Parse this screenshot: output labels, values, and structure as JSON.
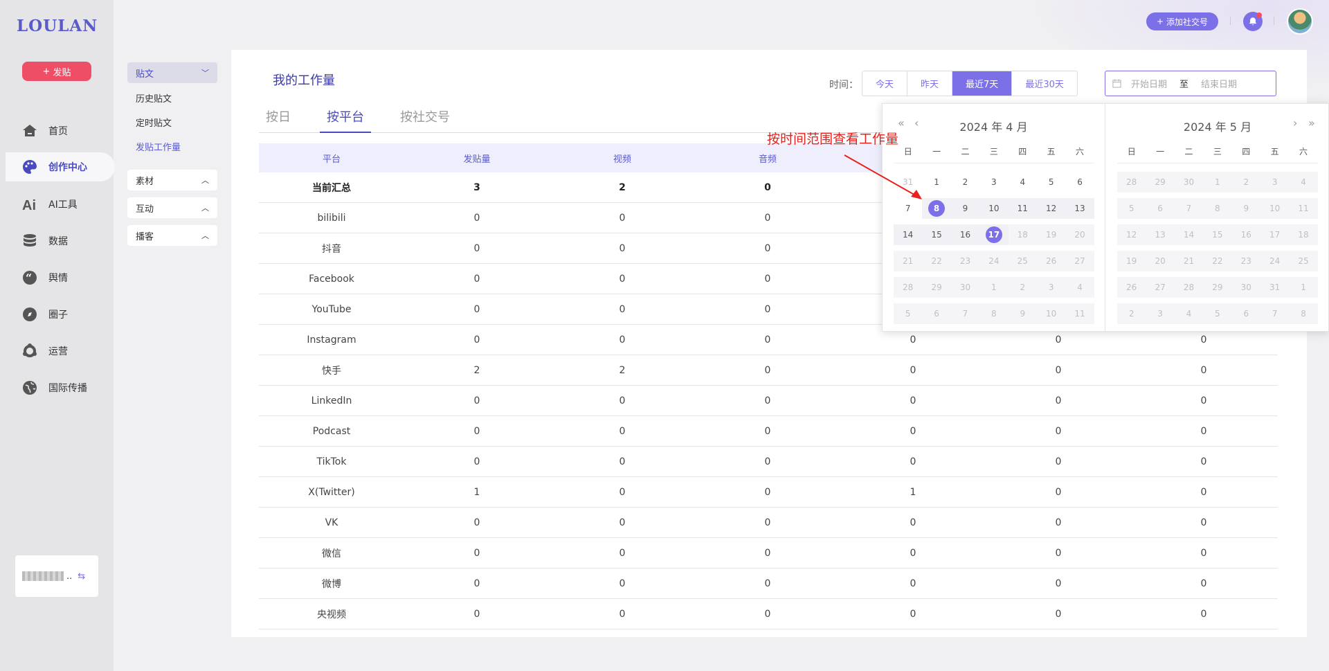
{
  "brand": {
    "logo": "LOULAN",
    "post_label": "发贴"
  },
  "nav": [
    {
      "label": "首页",
      "icon": "home-icon"
    },
    {
      "label": "创作中心",
      "icon": "palette-icon",
      "active": true
    },
    {
      "label": "AI工具",
      "icon": "ai-icon"
    },
    {
      "label": "数据",
      "icon": "database-icon"
    },
    {
      "label": "舆情",
      "icon": "quote-icon"
    },
    {
      "label": "圈子",
      "icon": "compass-icon"
    },
    {
      "label": "运营",
      "icon": "cluster-icon"
    },
    {
      "label": "国际传播",
      "icon": "globe-icon"
    }
  ],
  "account": {
    "suffix": ".."
  },
  "subnav": {
    "post_group": "贴文",
    "post_items": [
      "历史贴文",
      "定时贴文",
      "发贴工作量"
    ],
    "material": "素材",
    "interact": "互动",
    "podcast": "播客"
  },
  "topbar": {
    "add_social": "添加社交号"
  },
  "main": {
    "title": "我的工作量",
    "time_label": "时间：",
    "ranges": [
      "今天",
      "昨天",
      "最近7天",
      "最近30天"
    ],
    "active_range": 2,
    "start_placeholder": "开始日期",
    "to": "至",
    "end_placeholder": "结束日期",
    "tabs": [
      "按日",
      "按平台",
      "按社交号"
    ],
    "active_tab": 1
  },
  "table": {
    "headers": [
      "平台",
      "发贴量",
      "视频",
      "音频",
      "",
      "",
      ""
    ],
    "rows": [
      [
        "当前汇总",
        "3",
        "2",
        "0",
        "",
        "",
        ""
      ],
      [
        "bilibili",
        "0",
        "0",
        "0",
        "",
        "",
        ""
      ],
      [
        "抖音",
        "0",
        "0",
        "0",
        "",
        "",
        ""
      ],
      [
        "Facebook",
        "0",
        "0",
        "0",
        "",
        "",
        ""
      ],
      [
        "YouTube",
        "0",
        "0",
        "0",
        "",
        "",
        ""
      ],
      [
        "Instagram",
        "0",
        "0",
        "0",
        "0",
        "0",
        "0"
      ],
      [
        "快手",
        "2",
        "2",
        "0",
        "0",
        "0",
        "0"
      ],
      [
        "LinkedIn",
        "0",
        "0",
        "0",
        "0",
        "0",
        "0"
      ],
      [
        "Podcast",
        "0",
        "0",
        "0",
        "0",
        "0",
        "0"
      ],
      [
        "TikTok",
        "0",
        "0",
        "0",
        "0",
        "0",
        "0"
      ],
      [
        "X(Twitter)",
        "1",
        "0",
        "0",
        "1",
        "0",
        "0"
      ],
      [
        "VK",
        "0",
        "0",
        "0",
        "0",
        "0",
        "0"
      ],
      [
        "微信",
        "0",
        "0",
        "0",
        "0",
        "0",
        "0"
      ],
      [
        "微博",
        "0",
        "0",
        "0",
        "0",
        "0",
        "0"
      ],
      [
        "央视频",
        "0",
        "0",
        "0",
        "0",
        "0",
        "0"
      ]
    ]
  },
  "calendar": {
    "weekdays": [
      "日",
      "一",
      "二",
      "三",
      "四",
      "五",
      "六"
    ],
    "left_title": "2024 年 4 月",
    "right_title": "2024 年 5 月",
    "left_weeks": [
      [
        "31",
        "1",
        "2",
        "3",
        "4",
        "5",
        "6"
      ],
      [
        "7",
        "8",
        "9",
        "10",
        "11",
        "12",
        "13"
      ],
      [
        "14",
        "15",
        "16",
        "17",
        "18",
        "19",
        "20"
      ],
      [
        "21",
        "22",
        "23",
        "24",
        "25",
        "26",
        "27"
      ],
      [
        "28",
        "29",
        "30",
        "1",
        "2",
        "3",
        "4"
      ],
      [
        "5",
        "6",
        "7",
        "8",
        "9",
        "10",
        "11"
      ]
    ],
    "right_weeks": [
      [
        "28",
        "29",
        "30",
        "1",
        "2",
        "3",
        "4"
      ],
      [
        "5",
        "6",
        "7",
        "8",
        "9",
        "10",
        "11"
      ],
      [
        "12",
        "13",
        "14",
        "15",
        "16",
        "17",
        "18"
      ],
      [
        "19",
        "20",
        "21",
        "22",
        "23",
        "24",
        "25"
      ],
      [
        "26",
        "27",
        "28",
        "29",
        "30",
        "31",
        "1"
      ],
      [
        "2",
        "3",
        "4",
        "5",
        "6",
        "7",
        "8"
      ]
    ],
    "range_start": "8",
    "range_end": "17"
  },
  "annotation": "按时间范围查看工作量",
  "colors": {
    "accent": "#7b70e8",
    "brand_red": "#ef4e67",
    "annotation": "#e8201e"
  }
}
